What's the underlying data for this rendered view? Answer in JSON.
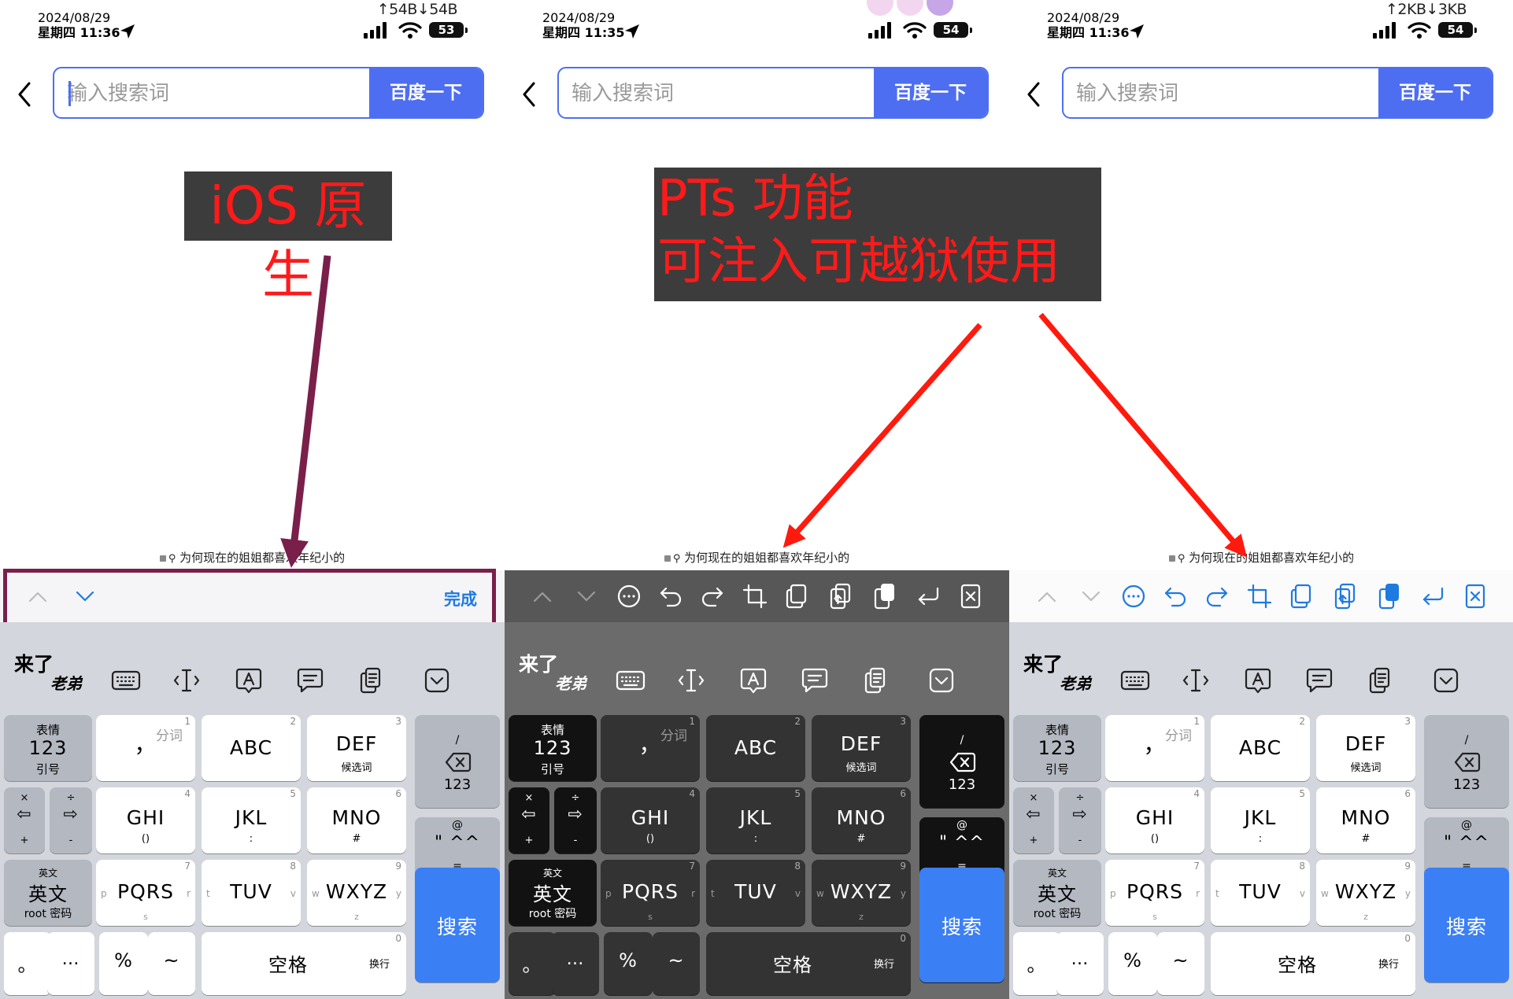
{
  "panels": [
    {
      "status": {
        "date": "2024/08/29",
        "day_time": "星期四 11:36",
        "net": "↑54B↓54B",
        "battery": "53"
      },
      "search": {
        "placeholder": "输入搜索词",
        "button": "百度一下"
      },
      "suggestion": "为何现在的姐姐都喜欢年纪小的",
      "toolbar": {
        "style": "ios",
        "done": "完成"
      },
      "keyboard": "light"
    },
    {
      "status": {
        "date": "2024/08/29",
        "day_time": "星期四 11:35",
        "net": "",
        "battery": "54"
      },
      "search": {
        "placeholder": "输入搜索词",
        "button": "百度一下"
      },
      "suggestion": "为何现在的姐姐都喜欢年纪小的",
      "toolbar": {
        "style": "dark"
      },
      "keyboard": "dark"
    },
    {
      "status": {
        "date": "2024/08/29",
        "day_time": "星期四 11:36",
        "net": "↑2KB↓3KB",
        "battery": "54"
      },
      "search": {
        "placeholder": "输入搜索词",
        "button": "百度一下"
      },
      "suggestion": "为何现在的姐姐都喜欢年纪小的",
      "toolbar": {
        "style": "light"
      },
      "keyboard": "light"
    }
  ],
  "keyboard_logo": {
    "line1": "来了",
    "line2": "老弟"
  },
  "keys": {
    "symbols": {
      "top": "表情",
      "main": "123",
      "bottom": "引号"
    },
    "punct": {
      "main": "，",
      "hint": "分词",
      "num": "1"
    },
    "abc": {
      "main": "ABC",
      "num": "2"
    },
    "def": {
      "main": "DEF",
      "sub": "候选词",
      "num": "3"
    },
    "backspace": {
      "top": "/",
      "bottom": "123"
    },
    "left": {
      "top": "×",
      "main": "⇦",
      "bottom": "+"
    },
    "right": {
      "top": "÷",
      "main": "⇨",
      "bottom": "-"
    },
    "ghi": {
      "main": "GHI",
      "sub": "()",
      "num": "4"
    },
    "jkl": {
      "main": "JKL",
      "sub": ":",
      "num": "5"
    },
    "mno": {
      "main": "MNO",
      "sub": "#",
      "num": "6"
    },
    "emoji": {
      "top": "@",
      "main": "\" ^^",
      "bottom": "="
    },
    "english": {
      "top": "英文",
      "main": "英文",
      "bottom": "root 密码"
    },
    "pqrs": {
      "main": "PQRS",
      "num": "7",
      "l": "p",
      "r": "r",
      "b": "s"
    },
    "tuv": {
      "main": "TUV",
      "num": "8",
      "l": "t",
      "r": "v"
    },
    "wxyz": {
      "main": "WXYZ",
      "num": "9",
      "l": "w",
      "r": "y",
      "b": "z"
    },
    "search": {
      "main": "搜索"
    },
    "period": {
      "main": "。"
    },
    "ellipsis": {
      "main": "…"
    },
    "percent": {
      "main": "%"
    },
    "tilde": {
      "main": "~"
    },
    "space": {
      "main": "空格",
      "sub": "换行",
      "num": "0"
    }
  },
  "annotations": {
    "label1": "iOS 原生",
    "label2_line1": "PTs 功能",
    "label2_line2": "可注入可越狱使用",
    "colors": {
      "arrow1": "#7a1f4a",
      "arrow2": "#ff1a0d",
      "label_bg": "#3c3c3c",
      "label_text": "#ff1a1a"
    }
  }
}
